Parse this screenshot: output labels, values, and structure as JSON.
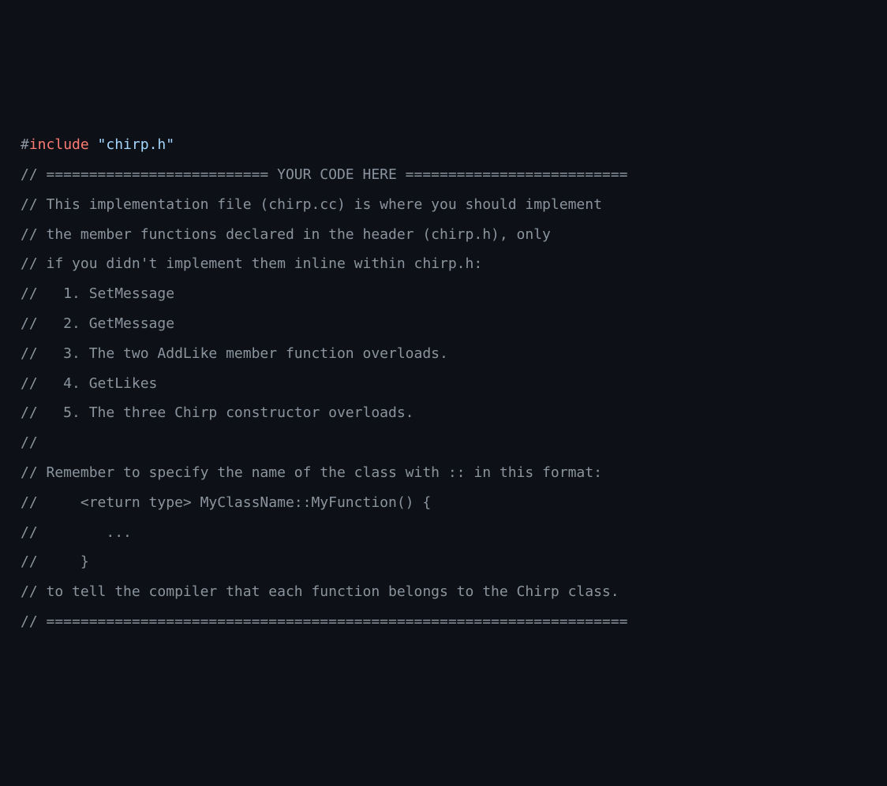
{
  "code": {
    "include_hash": "#",
    "include_keyword": "include ",
    "include_string": "\"chirp.h\"",
    "lines": [
      "// ========================== YOUR CODE HERE ==========================",
      "// This implementation file (chirp.cc) is where you should implement",
      "// the member functions declared in the header (chirp.h), only",
      "// if you didn't implement them inline within chirp.h:",
      "//   1. SetMessage",
      "//   2. GetMessage",
      "//   3. The two AddLike member function overloads.",
      "//   4. GetLikes",
      "//   5. The three Chirp constructor overloads.",
      "//",
      "// Remember to specify the name of the class with :: in this format:",
      "//     <return type> MyClassName::MyFunction() {",
      "//        ...",
      "//     }",
      "// to tell the compiler that each function belongs to the Chirp class.",
      "// ===================================================================="
    ]
  }
}
